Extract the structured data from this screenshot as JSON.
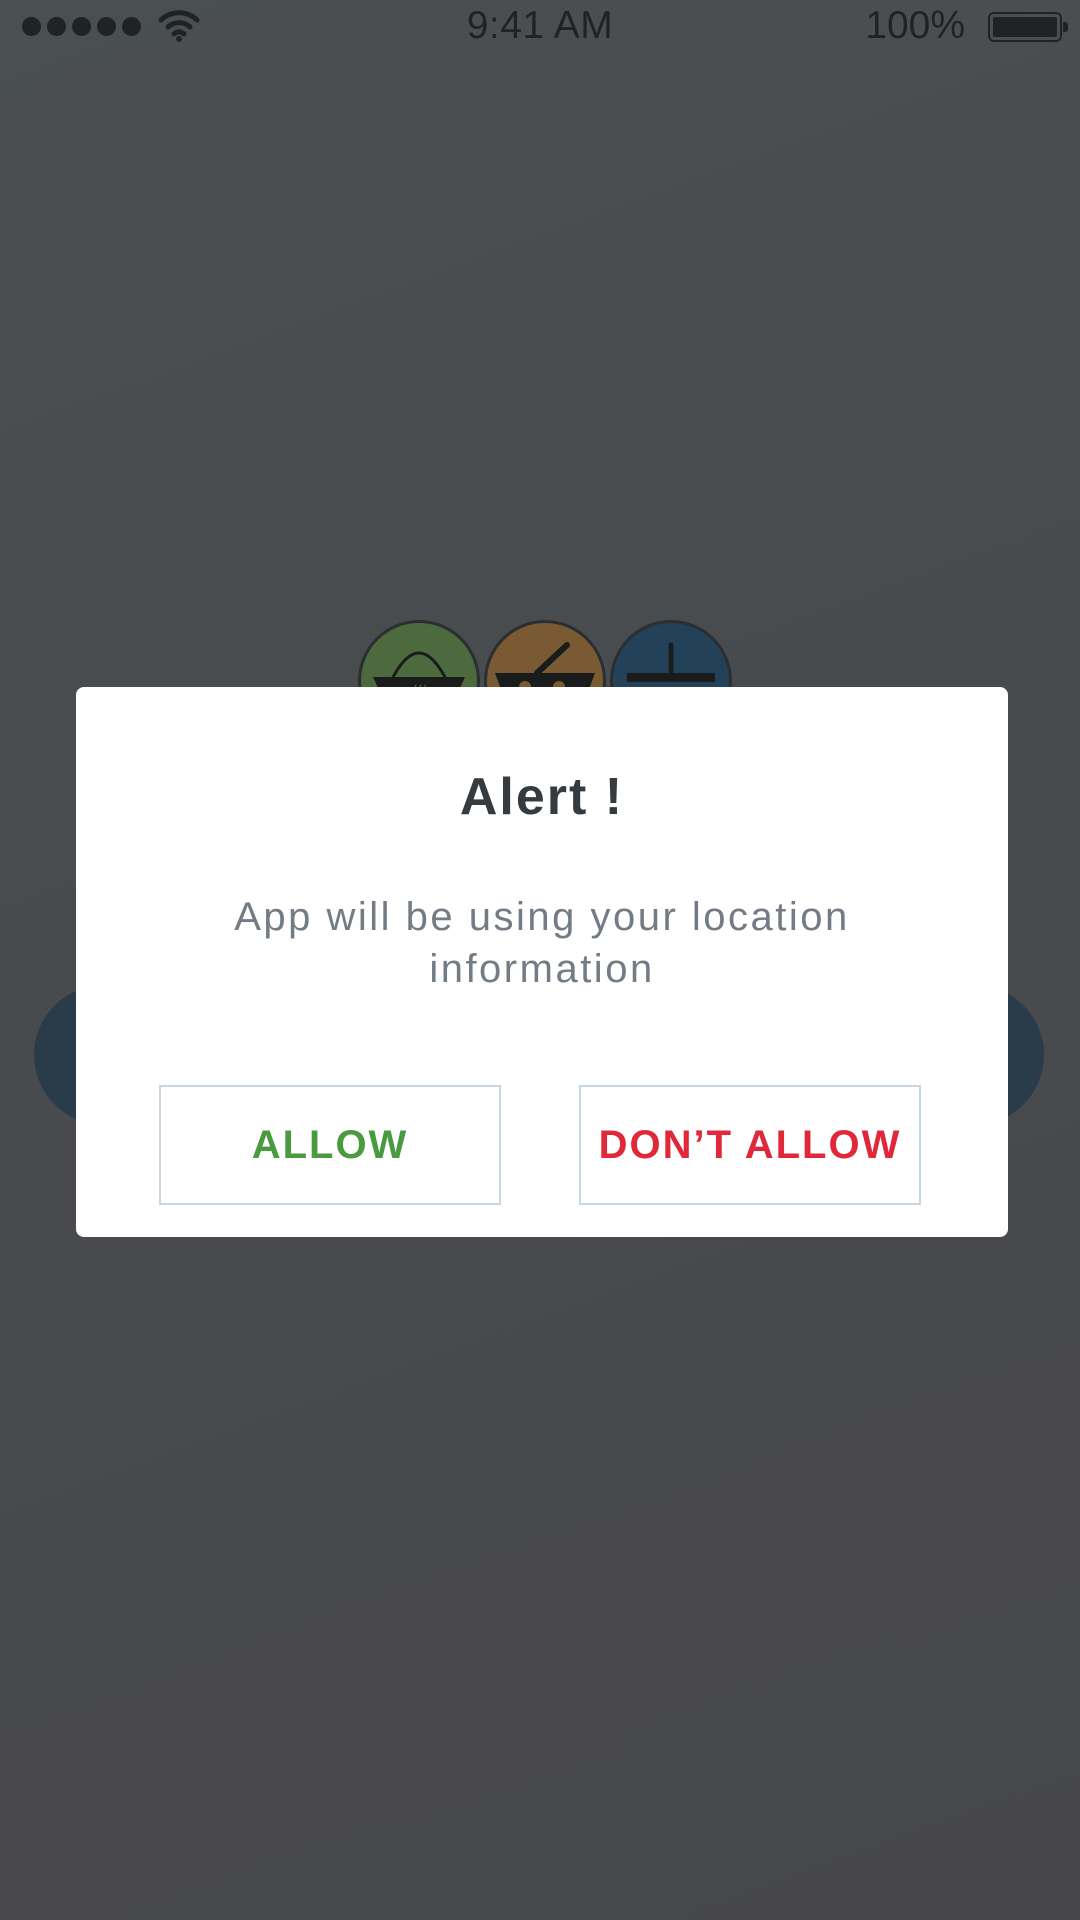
{
  "status_bar": {
    "time": "9:41 AM",
    "battery_percent": "100%",
    "battery_level": 1.0,
    "signal_bars": 5,
    "icons": [
      "signal-dots-icon",
      "wifi-icon",
      "battery-icon"
    ]
  },
  "background": {
    "category_icons": [
      {
        "icon": "basket-icon",
        "color": "#4d6a3e"
      },
      {
        "icon": "bowl-icon",
        "color": "#7a5a32"
      },
      {
        "icon": "tray-icon",
        "color": "#24415a"
      }
    ]
  },
  "alert": {
    "title": "Alert !",
    "message": "App will be using your location information",
    "allow_label": "ALLOW",
    "deny_label": "DON’T ALLOW",
    "allow_color": "#4a9b3f",
    "deny_color": "#e0283a"
  }
}
